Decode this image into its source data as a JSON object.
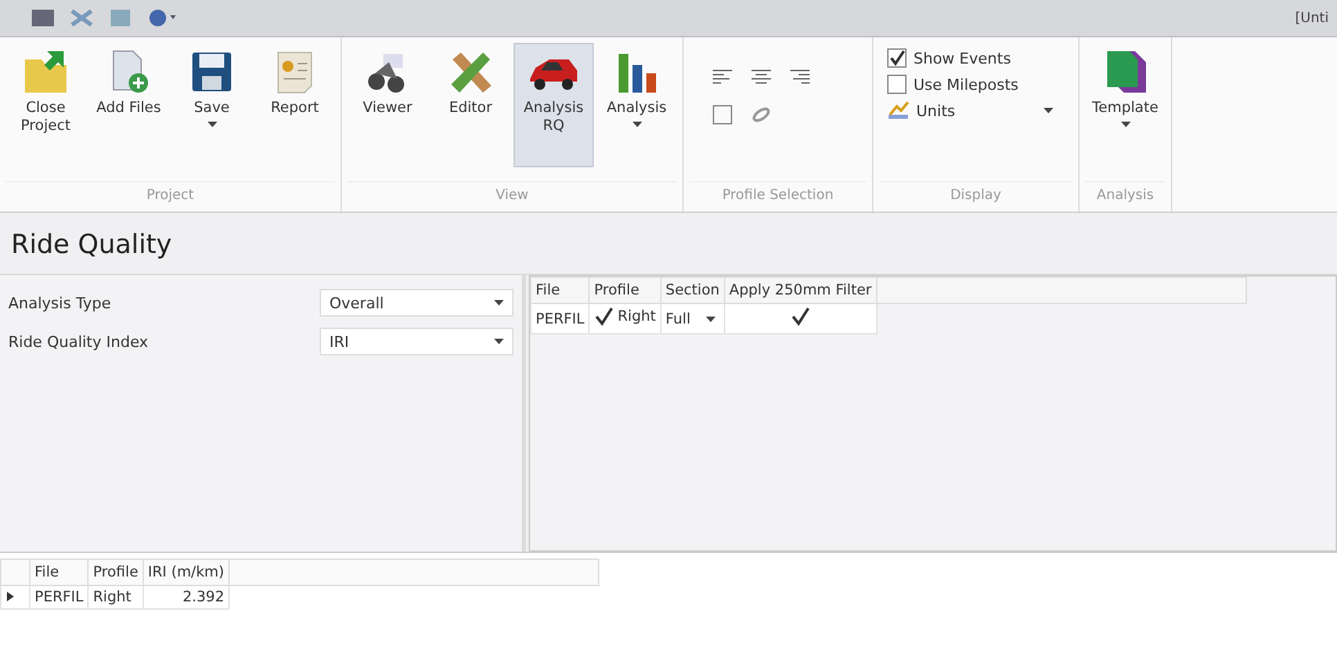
{
  "title_bar": {
    "title_fragment": "[Unti"
  },
  "ribbon": {
    "groups": [
      {
        "label": "Project",
        "kind": "buttons",
        "buttons": [
          {
            "label": "Close Project",
            "dropdown": false,
            "selected": false
          },
          {
            "label": "Add Files",
            "dropdown": false,
            "selected": false
          },
          {
            "label": "Save",
            "dropdown": true,
            "selected": false
          },
          {
            "label": "Report",
            "dropdown": false,
            "selected": false
          }
        ]
      },
      {
        "label": "View",
        "kind": "buttons",
        "buttons": [
          {
            "label": "Viewer",
            "dropdown": false,
            "selected": false
          },
          {
            "label": "Editor",
            "dropdown": false,
            "selected": false
          },
          {
            "label": "Analysis RQ",
            "dropdown": false,
            "selected": true
          },
          {
            "label": "Analysis",
            "dropdown": true,
            "selected": false
          }
        ]
      },
      {
        "label": "Profile Selection",
        "kind": "profile_tools"
      },
      {
        "label": "Display",
        "kind": "options",
        "items": [
          {
            "kind": "checkbox",
            "label": "Show Events",
            "checked": true
          },
          {
            "kind": "checkbox",
            "label": "Use Mileposts",
            "checked": false
          },
          {
            "kind": "dropdown",
            "label": "Units"
          }
        ]
      },
      {
        "label": "Analysis",
        "kind": "buttons",
        "buttons": [
          {
            "label": "Template",
            "dropdown": true,
            "selected": false
          }
        ]
      }
    ]
  },
  "page_title": "Ride Quality",
  "settings": [
    {
      "label": "Analysis Type",
      "value": "Overall"
    },
    {
      "label": "Ride Quality Index",
      "value": "IRI"
    }
  ],
  "profiles_table": {
    "columns": [
      "File",
      "Profile",
      "Section",
      "Apply 250mm Filter"
    ],
    "rows": [
      {
        "file": "PERFIL",
        "profile": "Right",
        "profile_checked": true,
        "section": "Full",
        "filter_checked": true
      }
    ]
  },
  "results_table": {
    "columns": [
      "File",
      "Profile",
      "IRI (m/km)"
    ],
    "rows": [
      {
        "current": true,
        "file": "PERFIL",
        "profile": "Right",
        "iri": "2.392"
      }
    ]
  }
}
